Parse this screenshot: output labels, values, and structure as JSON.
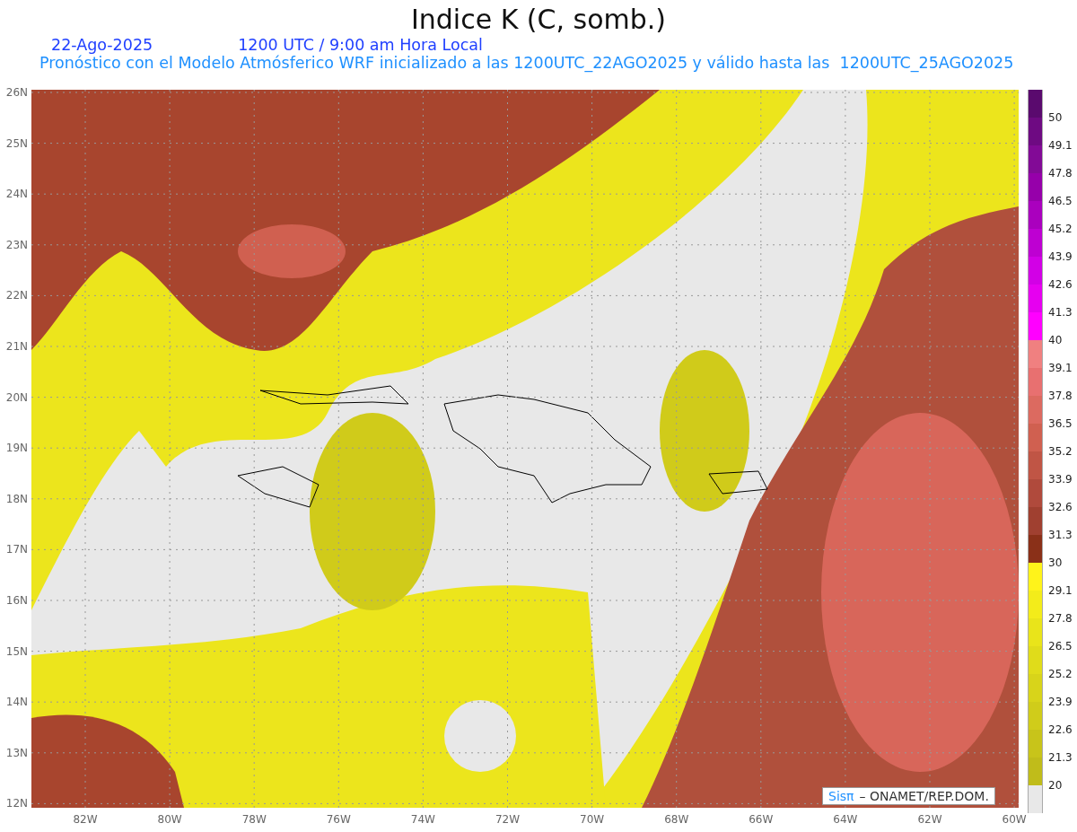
{
  "title": "Indice K (C, somb.)",
  "date": "22-Ago-2025",
  "time": "1200 UTC / 9:00 am Hora Local",
  "subtitle": "Pronóstico con el Modelo Atmósferico WRF inicializado a las 1200UTC_22AGO2025 y válido hasta las  1200UTC_25AGO2025",
  "map": {
    "y_labels": [
      "26N",
      "25N",
      "24N",
      "23N",
      "22N",
      "21N",
      "20N",
      "19N",
      "18N",
      "17N",
      "16N",
      "15N",
      "14N",
      "13N",
      "12N"
    ],
    "x_labels": [
      "82W",
      "80W",
      "78W",
      "76W",
      "74W",
      "72W",
      "70W",
      "68W",
      "66W",
      "64W",
      "62W",
      "60W"
    ],
    "credit": {
      "logo": "Sisπ",
      "text": "– ONAMET/REP.DOM."
    }
  },
  "legend": [
    {
      "color": "#5a0a6e",
      "label": "50"
    },
    {
      "color": "#6e0a82",
      "label": "49.1"
    },
    {
      "color": "#820a96",
      "label": "47.8"
    },
    {
      "color": "#9600aa",
      "label": "46.5"
    },
    {
      "color": "#aa00be",
      "label": "45.2"
    },
    {
      "color": "#be00d2",
      "label": "43.9"
    },
    {
      "color": "#d200e6",
      "label": "42.6"
    },
    {
      "color": "#e600f0",
      "label": "41.3"
    },
    {
      "color": "#ff00ff",
      "label": "40"
    },
    {
      "color": "#f08080",
      "label": "39.1"
    },
    {
      "color": "#e87070",
      "label": "37.8"
    },
    {
      "color": "#dc6a60",
      "label": "36.5"
    },
    {
      "color": "#d06050",
      "label": "35.2"
    },
    {
      "color": "#c05545",
      "label": "33.9"
    },
    {
      "color": "#b04a3c",
      "label": "32.6"
    },
    {
      "color": "#a04030",
      "label": "31.3"
    },
    {
      "color": "#8a3018",
      "label": "30"
    },
    {
      "color": "#fff31a",
      "label": "29.1"
    },
    {
      "color": "#f3ec1a",
      "label": "27.8"
    },
    {
      "color": "#e9e41a",
      "label": "26.5"
    },
    {
      "color": "#e0dc1a",
      "label": "25.2"
    },
    {
      "color": "#d8d41a",
      "label": "23.9"
    },
    {
      "color": "#d0cc1a",
      "label": "22.6"
    },
    {
      "color": "#c8c41a",
      "label": "21.3"
    },
    {
      "color": "#c0bc1a",
      "label": "20"
    },
    {
      "color": "#e8e8e8"
    }
  ]
}
